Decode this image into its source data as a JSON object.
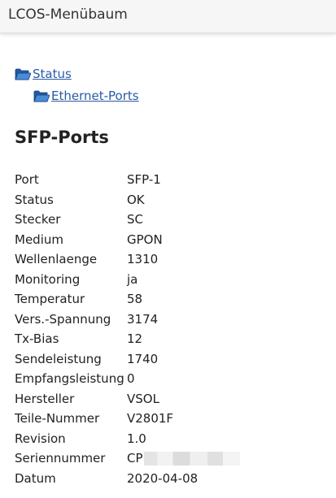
{
  "header": {
    "title": "LCOS-Menübaum"
  },
  "breadcrumb": [
    {
      "label": "Status",
      "icon": "folder-open-icon"
    },
    {
      "label": "Ethernet-Ports",
      "icon": "folder-open-icon"
    }
  ],
  "colors": {
    "link": "#2a5aa8",
    "folder": "#2f6fc0",
    "header_bg": "#f6f6f6"
  },
  "page": {
    "title": "SFP-Ports"
  },
  "properties": [
    {
      "key": "Port",
      "value": "SFP-1"
    },
    {
      "key": "Status",
      "value": "OK"
    },
    {
      "key": "Stecker",
      "value": "SC"
    },
    {
      "key": "Medium",
      "value": "GPON"
    },
    {
      "key": "Wellenlaenge",
      "value": "1310"
    },
    {
      "key": "Monitoring",
      "value": "ja"
    },
    {
      "key": "Temperatur",
      "value": "58"
    },
    {
      "key": "Vers.-Spannung",
      "value": "3174"
    },
    {
      "key": "Tx-Bias",
      "value": "12"
    },
    {
      "key": "Sendeleistung",
      "value": "1740"
    },
    {
      "key": "Empfangsleistung",
      "value": "0"
    },
    {
      "key": "Hersteller",
      "value": "VSOL"
    },
    {
      "key": "Teile-Nummer",
      "value": "V2801F"
    },
    {
      "key": "Revision",
      "value": "1.0"
    },
    {
      "key": "Seriennummer",
      "value": "CP"
    },
    {
      "key": "Datum",
      "value": "2020-04-08"
    }
  ]
}
